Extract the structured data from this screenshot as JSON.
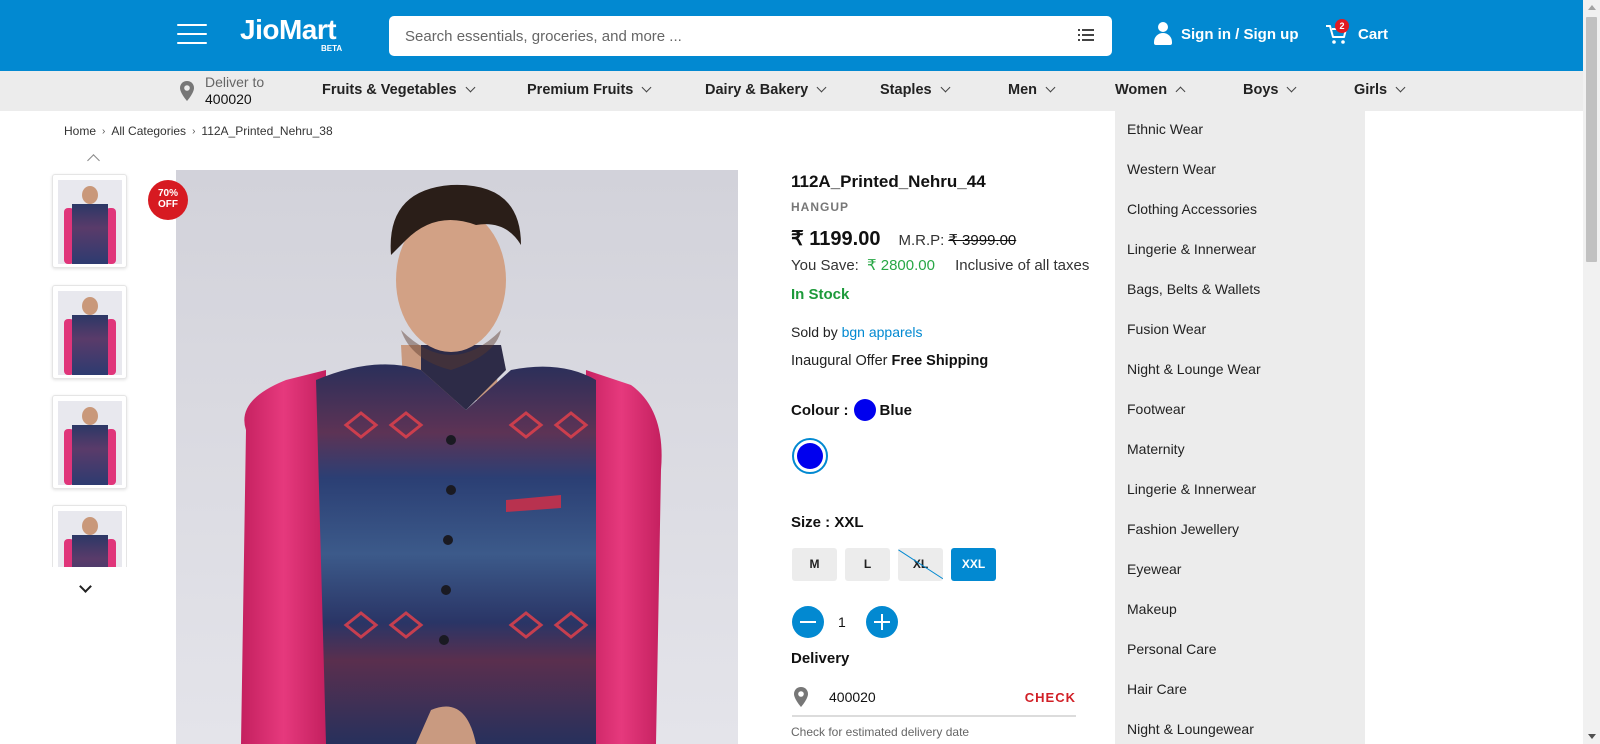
{
  "header": {
    "logo": "JioMart",
    "logo_tag": "BETA",
    "search_placeholder": "Search essentials, groceries, and more ...",
    "signin_label": "Sign in / Sign up",
    "cart_label": "Cart",
    "cart_count": "2",
    "accent_color": "#0289d1"
  },
  "nav": {
    "deliver_label": "Deliver to",
    "deliver_pincode": "400020",
    "items": [
      {
        "label": "Fruits & Vegetables"
      },
      {
        "label": "Premium Fruits"
      },
      {
        "label": "Dairy & Bakery"
      },
      {
        "label": "Staples"
      },
      {
        "label": "Men"
      },
      {
        "label": "Women"
      },
      {
        "label": "Boys"
      },
      {
        "label": "Girls"
      }
    ]
  },
  "breadcrumb": [
    "Home",
    "All Categories",
    "112A_Printed_Nehru_38"
  ],
  "product": {
    "discount_line1": "70%",
    "discount_line2": "OFF",
    "title": "112A_Printed_Nehru_44",
    "brand": "HANGUP",
    "price": "₹ 1199.00",
    "mrp_label": "M.R.P:",
    "mrp": "₹ 3999.00",
    "save_label": "You Save:",
    "save_amount": "₹ 2800.00",
    "tax_note": "Inclusive of all taxes",
    "stock": "In Stock",
    "sold_by_label": "Sold by",
    "seller": "bgn apparels",
    "offer_label": "Inaugural Offer",
    "offer": "Free Shipping",
    "colour_label": "Colour :",
    "colour": "Blue",
    "colour_hex": "#0000ee",
    "size_label": "Size : XXL",
    "sizes": [
      {
        "label": "M",
        "state": "available"
      },
      {
        "label": "L",
        "state": "available"
      },
      {
        "label": "XL",
        "state": "unavailable"
      },
      {
        "label": "XXL",
        "state": "selected"
      }
    ],
    "quantity": "1",
    "delivery_label": "Delivery",
    "delivery_pincode": "400020",
    "check_label": "CHECK",
    "delivery_note": "Check for estimated delivery date"
  },
  "women_menu": {
    "items": [
      "Ethnic Wear",
      "Western Wear",
      "Clothing Accessories",
      "Lingerie & Innerwear",
      "Bags, Belts & Wallets",
      "Fusion Wear",
      "Night & Lounge Wear",
      "Footwear",
      "Maternity",
      "Lingerie & Innerwear",
      "Fashion Jewellery",
      "Eyewear",
      "Makeup",
      "Personal Care",
      "Hair Care",
      "Night & Loungewear"
    ]
  }
}
